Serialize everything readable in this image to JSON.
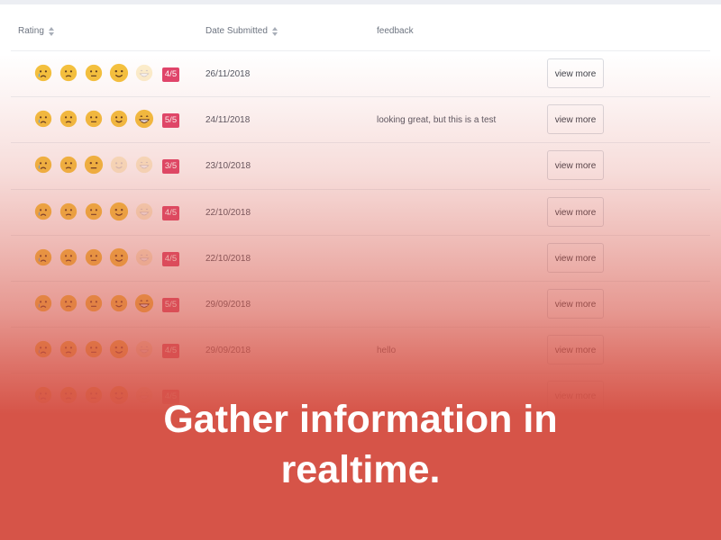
{
  "table": {
    "headers": {
      "rating": "Rating",
      "date": "Date Submitted",
      "feedback": "feedback"
    },
    "emoji_icons": [
      "crying-face-icon",
      "slightly-frowning-face-icon",
      "neutral-face-icon",
      "slightly-smiling-face-icon",
      "grinning-face-icon"
    ],
    "rows": [
      {
        "rating": 4,
        "badge": "4/5",
        "date": "26/11/2018",
        "feedback": "",
        "button": "view more"
      },
      {
        "rating": 5,
        "badge": "5/5",
        "date": "24/11/2018",
        "feedback": "looking great, but this is a test",
        "button": "view more"
      },
      {
        "rating": 3,
        "badge": "3/5",
        "date": "23/10/2018",
        "feedback": "",
        "button": "view more"
      },
      {
        "rating": 4,
        "badge": "4/5",
        "date": "22/10/2018",
        "feedback": "",
        "button": "view more"
      },
      {
        "rating": 4,
        "badge": "4/5",
        "date": "22/10/2018",
        "feedback": "",
        "button": "view more"
      },
      {
        "rating": 5,
        "badge": "5/5",
        "date": "29/09/2018",
        "feedback": "",
        "button": "view more"
      },
      {
        "rating": 4,
        "badge": "4/5",
        "date": "29/09/2018",
        "feedback": "hello",
        "button": "view more"
      },
      {
        "rating": 4,
        "badge": "4/5",
        "date": "",
        "feedback": "",
        "button": "view more"
      }
    ]
  },
  "headline": {
    "line1": "Gather information in",
    "line2": "realtime."
  },
  "colors": {
    "badge": "#e0446b",
    "overlay": "#d65448",
    "emoji": "#f4c23e"
  }
}
